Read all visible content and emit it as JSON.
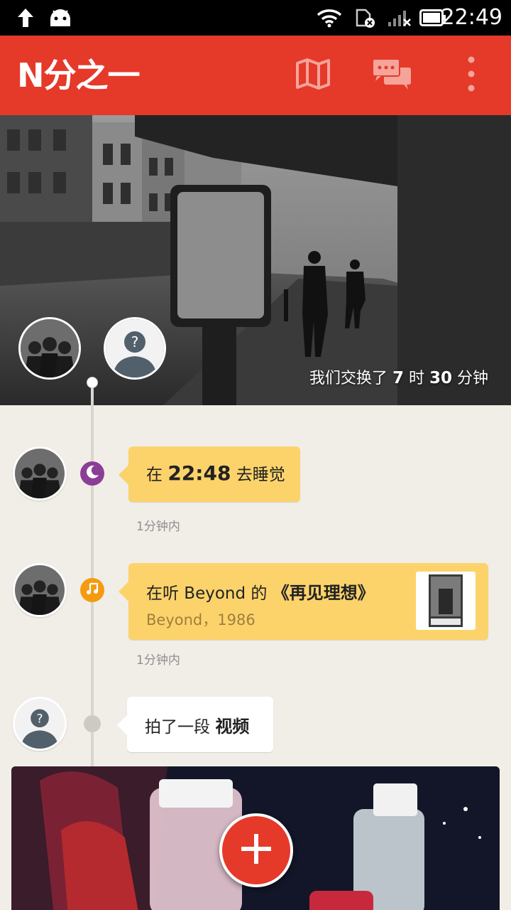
{
  "status_bar": {
    "time": "22:49",
    "icons": [
      "upload-icon",
      "android-icon",
      "wifi-icon",
      "sim-off-icon",
      "signal-icon",
      "battery-icon"
    ]
  },
  "app_bar": {
    "logo_text": "N分之一",
    "actions": [
      "map-icon",
      "chat-icon",
      "more-vert-icon"
    ],
    "color": "#e5392a"
  },
  "hero": {
    "caption_prefix": "我们交换了",
    "hours": "7",
    "hours_unit": "时",
    "minutes": "30",
    "minutes_unit": "分钟"
  },
  "timeline": [
    {
      "type": "sleep",
      "icon": "moon-icon",
      "icon_color": "#8c3d96",
      "text_prefix": "在",
      "text_bold": "22:48",
      "text_suffix": "去睡觉",
      "time_ago": "1分钟内"
    },
    {
      "type": "music",
      "icon": "music-note-icon",
      "icon_color": "#f49b10",
      "text_prefix": "在听 Beyond 的",
      "text_bold": "《再见理想》",
      "subtitle": "Beyond，1986",
      "album_icon": "album-cover",
      "time_ago": "1分钟内"
    },
    {
      "type": "video",
      "icon": "dot-icon",
      "icon_color": "#cdcac4",
      "text_prefix": "拍了一段",
      "text_bold": "视频"
    }
  ],
  "fab": {
    "icon": "plus-icon"
  }
}
